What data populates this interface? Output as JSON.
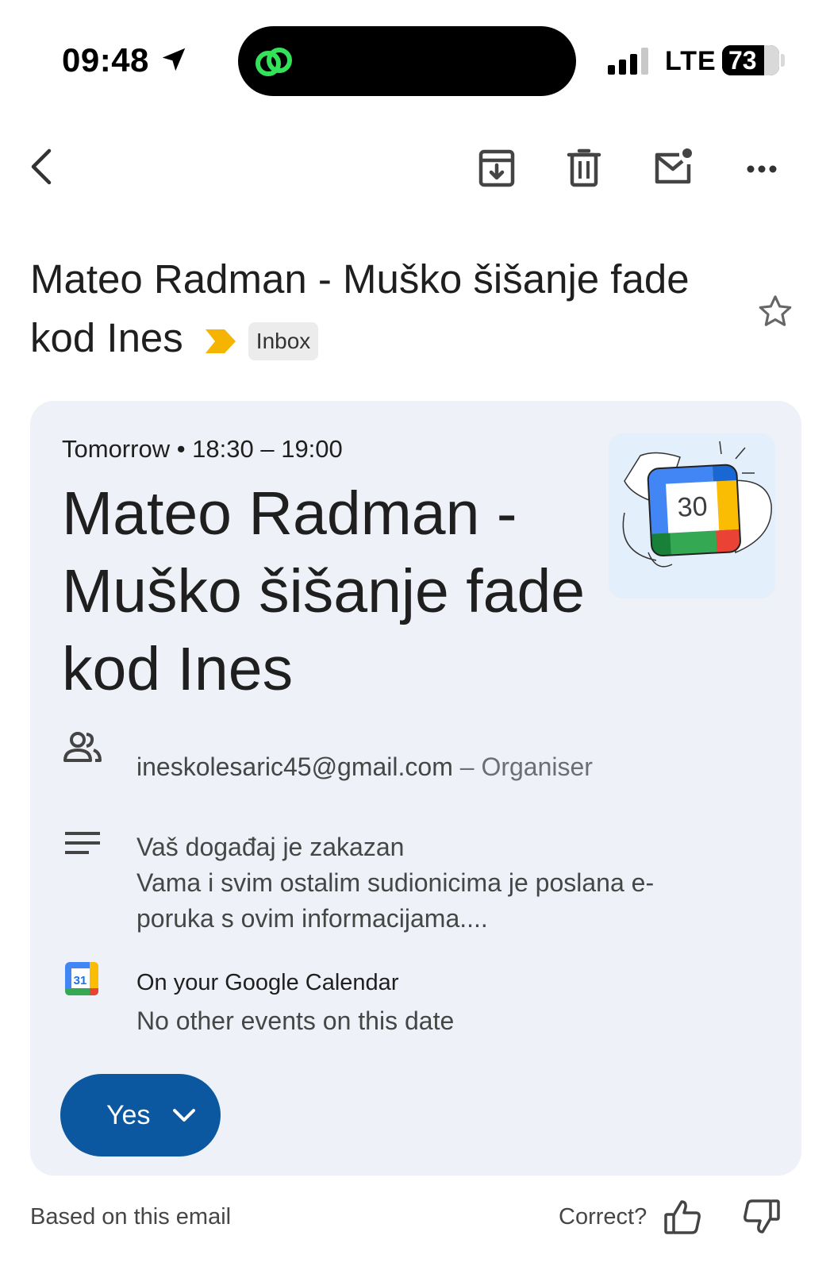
{
  "status_bar": {
    "time": "09:48",
    "network": "LTE",
    "battery": "73",
    "battery_level": 0.73
  },
  "toolbar": {
    "back_icon": "chevron-left-icon",
    "archive_icon": "archive-icon",
    "delete_icon": "trash-icon",
    "mark_unread_icon": "mail-unread-icon",
    "more_icon": "more-horizontal-icon"
  },
  "email": {
    "subject": "Mateo Radman - Muško šišanje fade kod Ines",
    "label": "Inbox"
  },
  "event_card": {
    "when": "Tomorrow • 18:30 – 19:00",
    "title": "Mateo Radman - Muško šišanje fade kod Ines",
    "organiser_email": "ineskolesaric45@gmail.com",
    "organiser_role": " – Organiser",
    "description_lines": [
      "Vaš događaj je zakazan",
      "Vama i svim ostalim sudionicima je poslana e-",
      "poruka s ovim informacijama...."
    ],
    "calendar_title": "On your Google Calendar",
    "calendar_status": "No other events on this date",
    "calendar_icon_day": "31",
    "illustration_day": "30",
    "rsvp_label": "Yes"
  },
  "footer": {
    "based_on": "Based on this email",
    "correct_prompt": "Correct?"
  },
  "colors": {
    "card_bg": "#eef1f7",
    "rsvp_button": "#0b57a0",
    "important_marker": "#f4b400"
  }
}
